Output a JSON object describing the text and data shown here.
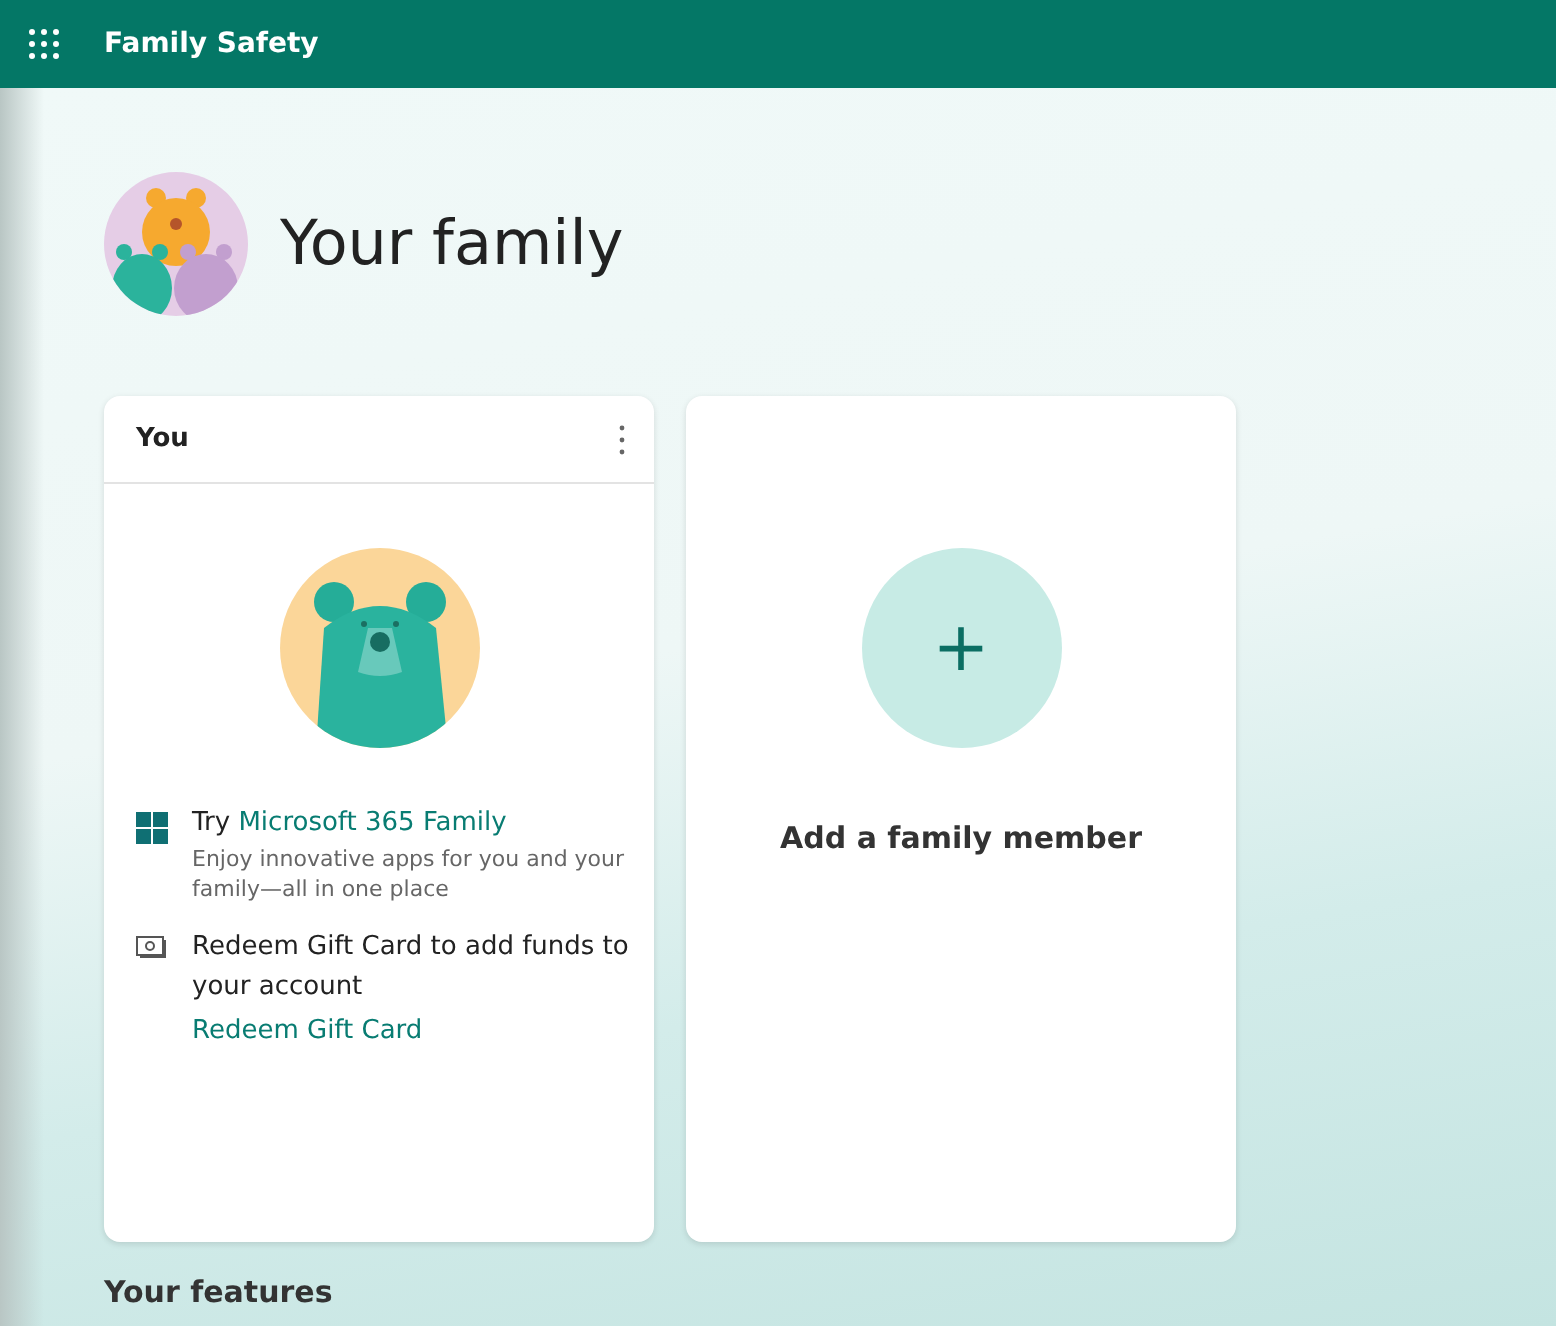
{
  "app_bar": {
    "title": "Family Safety"
  },
  "page": {
    "title": "Your family"
  },
  "member_card": {
    "name": "You",
    "offers": [
      {
        "kind": "promo",
        "lead": "Try",
        "link": "Microsoft 365 Family",
        "description": "Enjoy innovative apps for you and your family—all in one place"
      },
      {
        "kind": "gift",
        "text": "Redeem Gift Card to add funds to your account",
        "link": "Redeem Gift Card"
      }
    ]
  },
  "add_card": {
    "plus": "+",
    "label": "Add a family member"
  },
  "section": {
    "title": "Your features"
  }
}
